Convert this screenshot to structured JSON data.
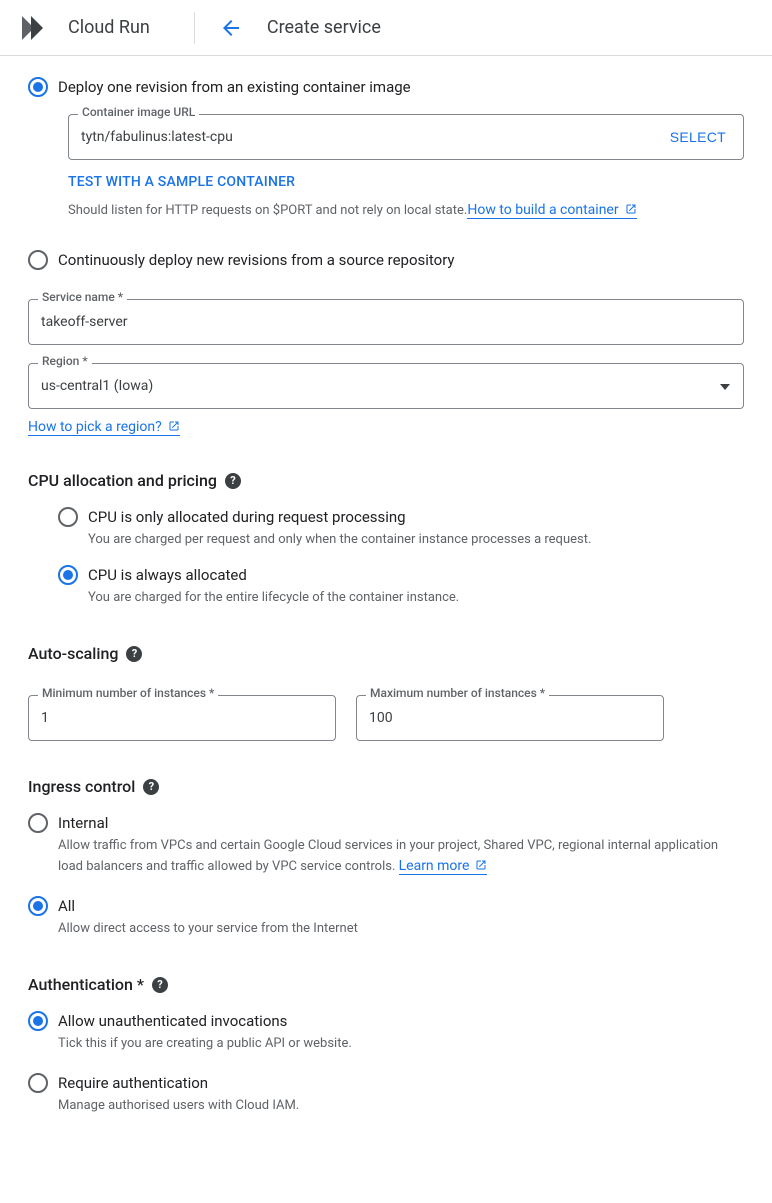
{
  "header": {
    "product": "Cloud Run",
    "page_title": "Create service"
  },
  "deploy_mode": {
    "existing_image_label": "Deploy one revision from an existing container image",
    "continuous_label": "Continuously deploy new revisions from a source repository"
  },
  "container": {
    "url_label": "Container image URL",
    "url_value": "tytn/fabulinus:latest-cpu",
    "select_btn": "SELECT",
    "test_link": "TEST WITH A SAMPLE CONTAINER",
    "help_text": "Should listen for HTTP requests on $PORT and not rely on local state.",
    "how_to_build_link": "How to build a container"
  },
  "service": {
    "name_label": "Service name *",
    "name_value": "takeoff-server",
    "region_label": "Region *",
    "region_value": "us-central1 (Iowa)",
    "region_help_link": "How to pick a region?"
  },
  "cpu": {
    "section_title": "CPU allocation and pricing",
    "request_label": "CPU is only allocated during request processing",
    "request_desc": "You are charged per request and only when the container instance processes a request.",
    "always_label": "CPU is always allocated",
    "always_desc": "You are charged for the entire lifecycle of the container instance."
  },
  "autoscaling": {
    "section_title": "Auto-scaling",
    "min_label": "Minimum number of instances *",
    "min_value": "1",
    "max_label": "Maximum number of instances *",
    "max_value": "100"
  },
  "ingress": {
    "section_title": "Ingress control",
    "internal_label": "Internal",
    "internal_desc": "Allow traffic from VPCs and certain Google Cloud services in your project, Shared VPC, regional internal application load balancers and traffic allowed by VPC service controls.",
    "learn_more": "Learn more",
    "all_label": "All",
    "all_desc": "Allow direct access to your service from the Internet"
  },
  "auth": {
    "section_title": "Authentication *",
    "unauth_label": "Allow unauthenticated invocations",
    "unauth_desc": "Tick this if you are creating a public API or website.",
    "require_label": "Require authentication",
    "require_desc": "Manage authorised users with Cloud IAM."
  }
}
